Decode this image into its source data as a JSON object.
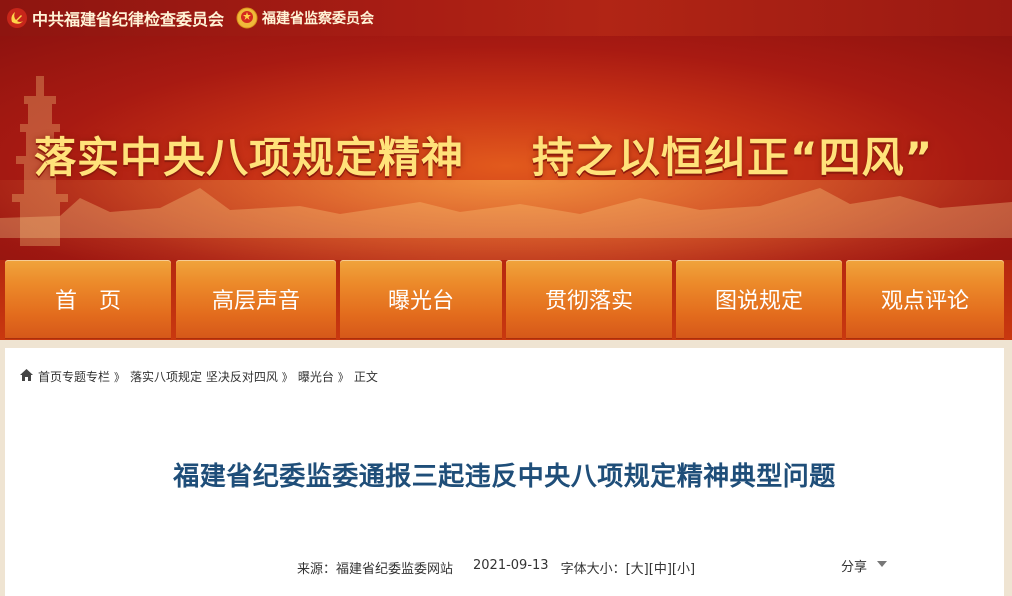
{
  "topbar": {
    "org1": "中共福建省纪律检查委员会",
    "org2": "福建省监察委员会",
    "party_emblem_icon": "hammer-sickle-icon",
    "state_emblem_icon": "national-emblem-icon"
  },
  "banner": {
    "slogan_left": "落实中央八项规定精神",
    "slogan_right": "持之以恒纠正“四风”"
  },
  "nav": {
    "items": [
      {
        "label": "首　页"
      },
      {
        "label": "高层声音"
      },
      {
        "label": "曝光台"
      },
      {
        "label": "贯彻落实"
      },
      {
        "label": "图说规定"
      },
      {
        "label": "观点评论"
      }
    ]
  },
  "breadcrumb": {
    "items": [
      "首页专题专栏",
      "落实八项规定 坚决反对四风",
      "曝光台"
    ],
    "separator": "》",
    "current": "正文"
  },
  "article": {
    "title": "福建省纪委监委通报三起违反中央八项规定精神典型问题",
    "source": "来源：福建省纪委监委网站",
    "date": "2021-09-13",
    "font_size_label": "字体大小：",
    "font_large": "[大]",
    "font_medium": "[中]",
    "font_small": "[小]",
    "share": "分享"
  },
  "colors": {
    "topbar": "#a81d14",
    "banner": "#c83216",
    "slogan": "#ffe27a",
    "nav_item": "#e36c1d",
    "title": "#1f4e79"
  }
}
